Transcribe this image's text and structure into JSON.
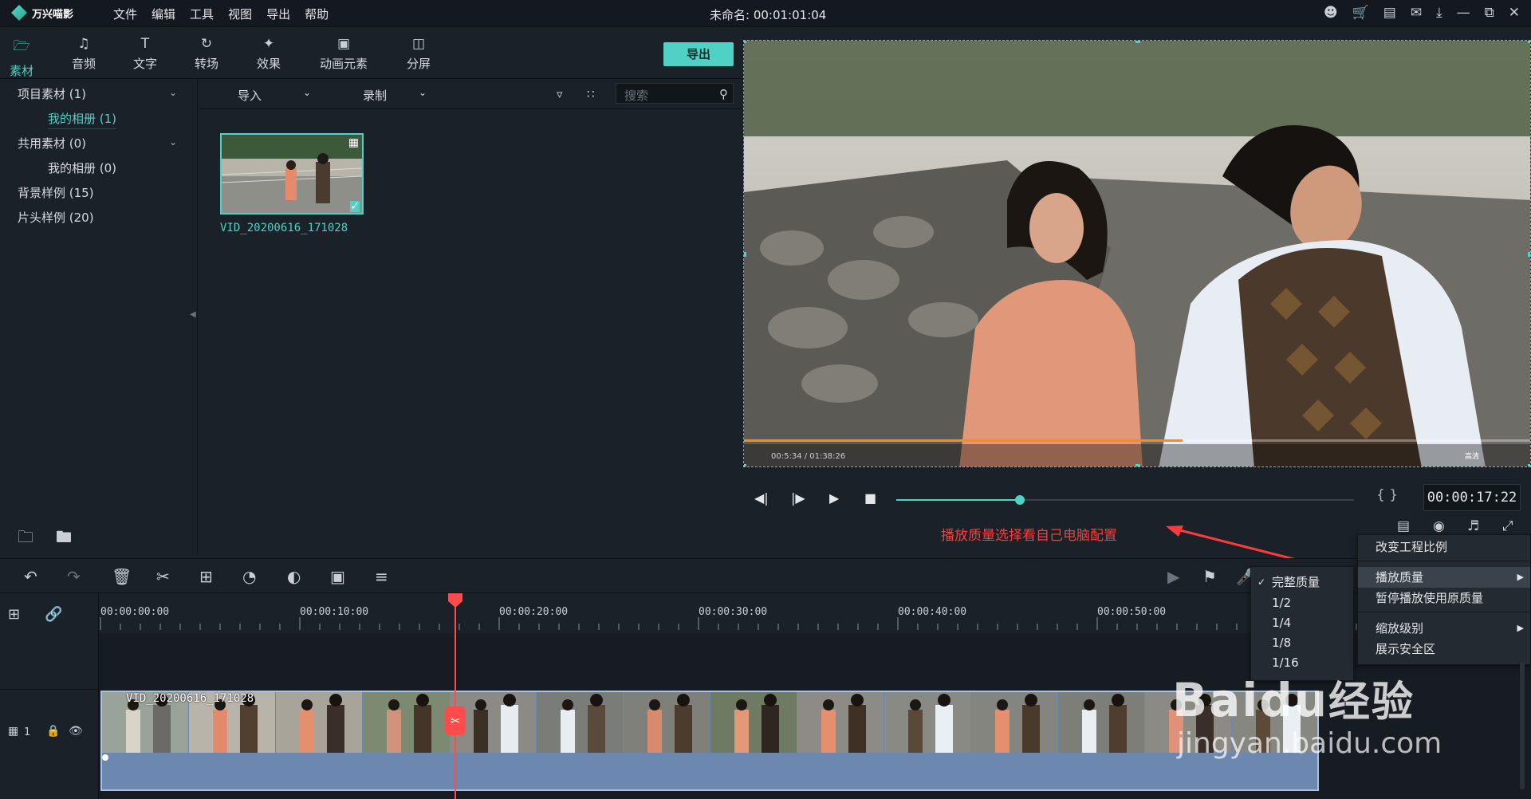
{
  "app": {
    "name": "万兴喵影",
    "project_title": "未命名: 00:01:01:04"
  },
  "menu": [
    "文件",
    "编辑",
    "工具",
    "视图",
    "导出",
    "帮助"
  ],
  "tool_tabs": [
    {
      "label": "素材",
      "icon": "folder-icon"
    },
    {
      "label": "音频",
      "icon": "music-note-icon"
    },
    {
      "label": "文字",
      "icon": "text-icon"
    },
    {
      "label": "转场",
      "icon": "transition-icon"
    },
    {
      "label": "效果",
      "icon": "effects-icon"
    },
    {
      "label": "动画元素",
      "icon": "image-icon"
    },
    {
      "label": "分屏",
      "icon": "split-screen-icon"
    }
  ],
  "export_label": "导出",
  "sidebar": {
    "items": [
      {
        "label": "项目素材 (1)"
      },
      {
        "label": "我的相册 (1)"
      },
      {
        "label": "共用素材 (0)"
      },
      {
        "label": "我的相册 (0)"
      },
      {
        "label": "背景样例 (15)"
      },
      {
        "label": "片头样例 (20)"
      }
    ]
  },
  "media_toolbar": {
    "import_label": "导入",
    "record_label": "录制",
    "search_placeholder": "搜索"
  },
  "media_item": {
    "name": "VID_20200616_171028"
  },
  "preview": {
    "timecode": "00:00:17:22",
    "scrub_progress": 0.27,
    "player_overlay_time": "00:5:34 / 01:38:26",
    "player_overlay_badge": "高清"
  },
  "annotation": "播放质量选择看自己电脑配置",
  "timeline": {
    "ticks": [
      "00:00:00:00",
      "00:00:10:00",
      "00:00:20:00",
      "00:00:30:00",
      "00:00:40:00",
      "00:00:50:00"
    ],
    "track_label": "1",
    "clip_name": "VID_20200616_171028"
  },
  "context_menu": {
    "items": [
      "改变工程比例",
      "播放质量",
      "暂停播放使用原质量",
      "缩放级别",
      "展示安全区"
    ]
  },
  "quality_submenu": {
    "items": [
      "完整质量",
      "1/2",
      "1/4",
      "1/8",
      "1/16"
    ]
  },
  "watermark": {
    "brand": "Baidu",
    "brand_cn": "经验",
    "url": "jingyan.baidu.com"
  }
}
